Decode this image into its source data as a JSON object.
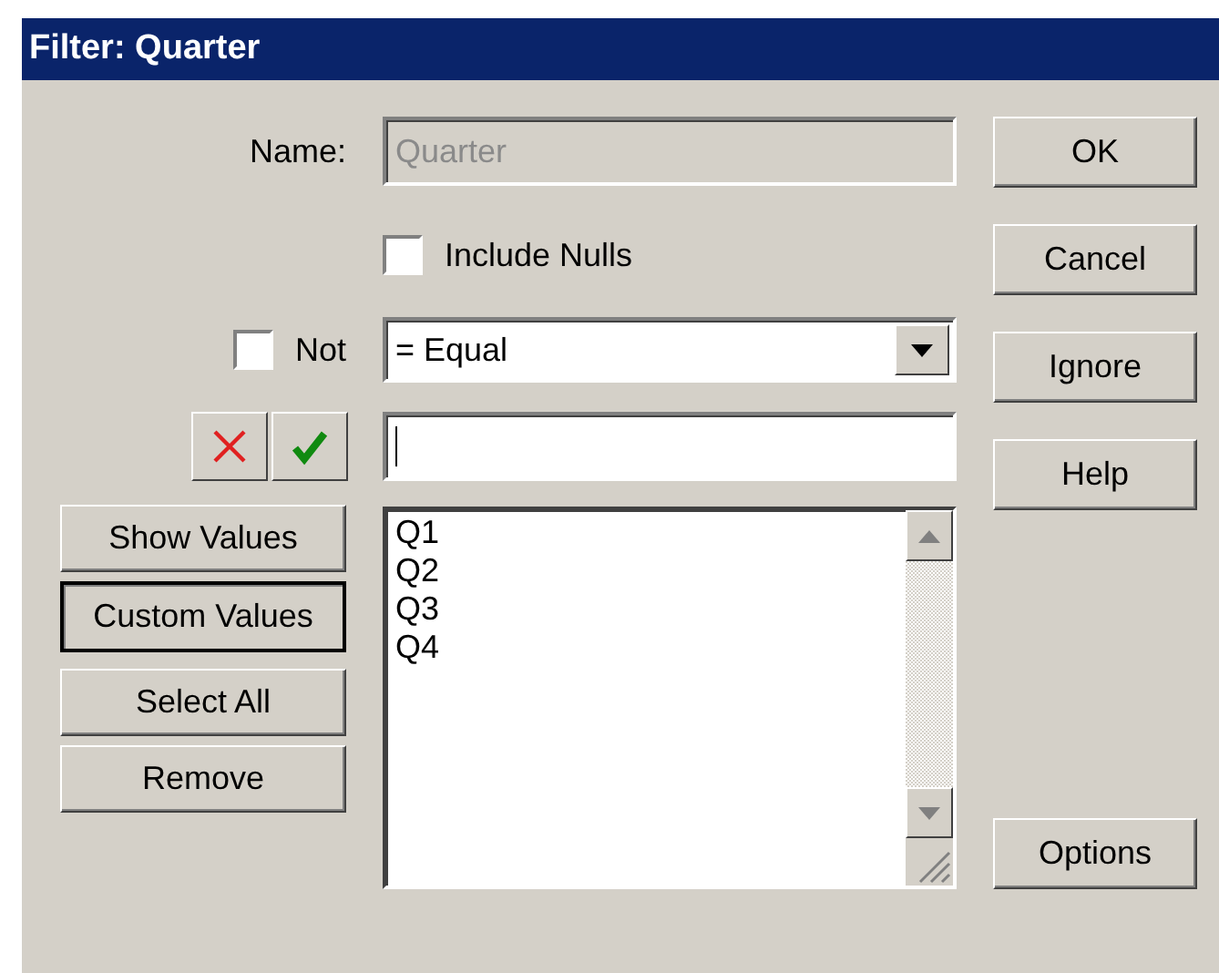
{
  "window": {
    "title": "Filter: Quarter"
  },
  "name_field": {
    "label": "Name:",
    "value": "Quarter",
    "disabled": true
  },
  "include_nulls": {
    "label": "Include Nulls",
    "checked": false
  },
  "not_option": {
    "label": "Not",
    "checked": false
  },
  "operator": {
    "value": "= Equal"
  },
  "side_buttons": [
    {
      "label": "Show Values",
      "selected": false
    },
    {
      "label": "Custom Values",
      "selected": true
    },
    {
      "label": "Select All",
      "selected": false
    },
    {
      "label": "Remove",
      "selected": false
    }
  ],
  "values_list": [
    "Q1",
    "Q2",
    "Q3",
    "Q4"
  ],
  "dialog_buttons": [
    "OK",
    "Cancel",
    "Ignore",
    "Help"
  ],
  "options_button": "Options"
}
